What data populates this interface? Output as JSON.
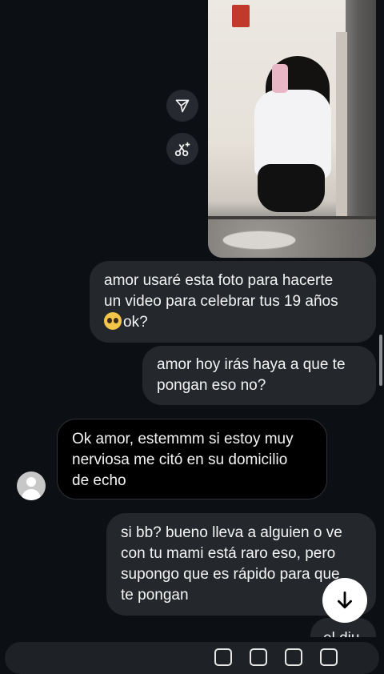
{
  "messages": [
    {
      "lines": [
        "amor usaré esta foto para hacerte",
        "un video para celebrar tus 19 años",
        "ok?"
      ],
      "emoji": "pleading-face"
    },
    {
      "lines": [
        "amor hoy irás haya a que te",
        "pongan eso no?"
      ]
    },
    {
      "lines": [
        "Ok amor, estemmm si estoy muy",
        "nerviosa me citó en su domicilio",
        "de echo"
      ]
    },
    {
      "lines": [
        "si bb? bueno lleva a alguien o ve",
        "con tu mami está raro eso, pero",
        "supongo que es rápido para que",
        "te pongan"
      ]
    },
    {
      "lines": [
        "el diu"
      ]
    }
  ],
  "icons": {
    "share": "paper-plane-icon",
    "ai_edit": "scissors-sparkle-icon",
    "scroll": "arrow-down-icon",
    "avatar": "default-avatar-icon"
  }
}
